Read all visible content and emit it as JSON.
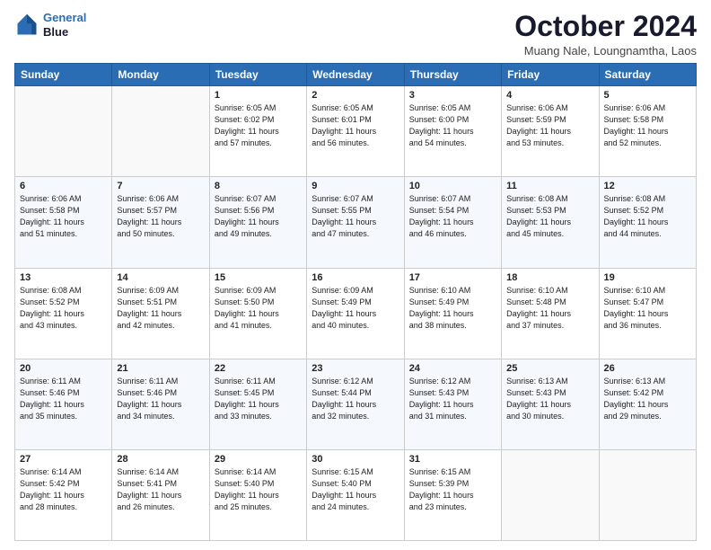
{
  "header": {
    "logo_line1": "General",
    "logo_line2": "Blue",
    "month": "October 2024",
    "location": "Muang Nale, Loungnamtha, Laos"
  },
  "days_of_week": [
    "Sunday",
    "Monday",
    "Tuesday",
    "Wednesday",
    "Thursday",
    "Friday",
    "Saturday"
  ],
  "weeks": [
    [
      {
        "day": "",
        "info": ""
      },
      {
        "day": "",
        "info": ""
      },
      {
        "day": "1",
        "info": "Sunrise: 6:05 AM\nSunset: 6:02 PM\nDaylight: 11 hours\nand 57 minutes."
      },
      {
        "day": "2",
        "info": "Sunrise: 6:05 AM\nSunset: 6:01 PM\nDaylight: 11 hours\nand 56 minutes."
      },
      {
        "day": "3",
        "info": "Sunrise: 6:05 AM\nSunset: 6:00 PM\nDaylight: 11 hours\nand 54 minutes."
      },
      {
        "day": "4",
        "info": "Sunrise: 6:06 AM\nSunset: 5:59 PM\nDaylight: 11 hours\nand 53 minutes."
      },
      {
        "day": "5",
        "info": "Sunrise: 6:06 AM\nSunset: 5:58 PM\nDaylight: 11 hours\nand 52 minutes."
      }
    ],
    [
      {
        "day": "6",
        "info": "Sunrise: 6:06 AM\nSunset: 5:58 PM\nDaylight: 11 hours\nand 51 minutes."
      },
      {
        "day": "7",
        "info": "Sunrise: 6:06 AM\nSunset: 5:57 PM\nDaylight: 11 hours\nand 50 minutes."
      },
      {
        "day": "8",
        "info": "Sunrise: 6:07 AM\nSunset: 5:56 PM\nDaylight: 11 hours\nand 49 minutes."
      },
      {
        "day": "9",
        "info": "Sunrise: 6:07 AM\nSunset: 5:55 PM\nDaylight: 11 hours\nand 47 minutes."
      },
      {
        "day": "10",
        "info": "Sunrise: 6:07 AM\nSunset: 5:54 PM\nDaylight: 11 hours\nand 46 minutes."
      },
      {
        "day": "11",
        "info": "Sunrise: 6:08 AM\nSunset: 5:53 PM\nDaylight: 11 hours\nand 45 minutes."
      },
      {
        "day": "12",
        "info": "Sunrise: 6:08 AM\nSunset: 5:52 PM\nDaylight: 11 hours\nand 44 minutes."
      }
    ],
    [
      {
        "day": "13",
        "info": "Sunrise: 6:08 AM\nSunset: 5:52 PM\nDaylight: 11 hours\nand 43 minutes."
      },
      {
        "day": "14",
        "info": "Sunrise: 6:09 AM\nSunset: 5:51 PM\nDaylight: 11 hours\nand 42 minutes."
      },
      {
        "day": "15",
        "info": "Sunrise: 6:09 AM\nSunset: 5:50 PM\nDaylight: 11 hours\nand 41 minutes."
      },
      {
        "day": "16",
        "info": "Sunrise: 6:09 AM\nSunset: 5:49 PM\nDaylight: 11 hours\nand 40 minutes."
      },
      {
        "day": "17",
        "info": "Sunrise: 6:10 AM\nSunset: 5:49 PM\nDaylight: 11 hours\nand 38 minutes."
      },
      {
        "day": "18",
        "info": "Sunrise: 6:10 AM\nSunset: 5:48 PM\nDaylight: 11 hours\nand 37 minutes."
      },
      {
        "day": "19",
        "info": "Sunrise: 6:10 AM\nSunset: 5:47 PM\nDaylight: 11 hours\nand 36 minutes."
      }
    ],
    [
      {
        "day": "20",
        "info": "Sunrise: 6:11 AM\nSunset: 5:46 PM\nDaylight: 11 hours\nand 35 minutes."
      },
      {
        "day": "21",
        "info": "Sunrise: 6:11 AM\nSunset: 5:46 PM\nDaylight: 11 hours\nand 34 minutes."
      },
      {
        "day": "22",
        "info": "Sunrise: 6:11 AM\nSunset: 5:45 PM\nDaylight: 11 hours\nand 33 minutes."
      },
      {
        "day": "23",
        "info": "Sunrise: 6:12 AM\nSunset: 5:44 PM\nDaylight: 11 hours\nand 32 minutes."
      },
      {
        "day": "24",
        "info": "Sunrise: 6:12 AM\nSunset: 5:43 PM\nDaylight: 11 hours\nand 31 minutes."
      },
      {
        "day": "25",
        "info": "Sunrise: 6:13 AM\nSunset: 5:43 PM\nDaylight: 11 hours\nand 30 minutes."
      },
      {
        "day": "26",
        "info": "Sunrise: 6:13 AM\nSunset: 5:42 PM\nDaylight: 11 hours\nand 29 minutes."
      }
    ],
    [
      {
        "day": "27",
        "info": "Sunrise: 6:14 AM\nSunset: 5:42 PM\nDaylight: 11 hours\nand 28 minutes."
      },
      {
        "day": "28",
        "info": "Sunrise: 6:14 AM\nSunset: 5:41 PM\nDaylight: 11 hours\nand 26 minutes."
      },
      {
        "day": "29",
        "info": "Sunrise: 6:14 AM\nSunset: 5:40 PM\nDaylight: 11 hours\nand 25 minutes."
      },
      {
        "day": "30",
        "info": "Sunrise: 6:15 AM\nSunset: 5:40 PM\nDaylight: 11 hours\nand 24 minutes."
      },
      {
        "day": "31",
        "info": "Sunrise: 6:15 AM\nSunset: 5:39 PM\nDaylight: 11 hours\nand 23 minutes."
      },
      {
        "day": "",
        "info": ""
      },
      {
        "day": "",
        "info": ""
      }
    ]
  ]
}
